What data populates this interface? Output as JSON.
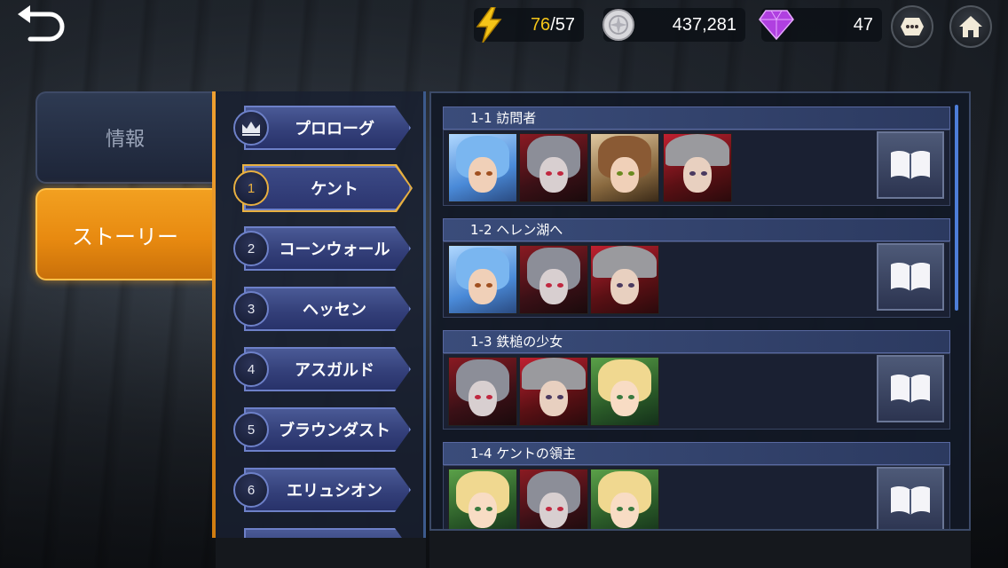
{
  "header": {
    "energy": "76/57",
    "energy_current": "76",
    "energy_max": "/57",
    "silver": "437,281",
    "gems": "47"
  },
  "tabs": [
    {
      "label": "情報",
      "active": false
    },
    {
      "label": "ストーリー",
      "active": true
    }
  ],
  "chapters": [
    {
      "badge": "",
      "label": "プロローグ",
      "icon": "crown-icon",
      "active": false
    },
    {
      "badge": "1",
      "label": "ケント",
      "active": true
    },
    {
      "badge": "2",
      "label": "コーンウォール",
      "active": false
    },
    {
      "badge": "3",
      "label": "ヘッセン",
      "active": false
    },
    {
      "badge": "4",
      "label": "アスガルド",
      "active": false
    },
    {
      "badge": "5",
      "label": "ブラウンダスト",
      "active": false
    },
    {
      "badge": "6",
      "label": "エリュシオン",
      "active": false
    }
  ],
  "episodes": [
    {
      "title": "1-1 訪問者",
      "portraits": [
        "blue-haired-elf",
        "gray-haired-knight",
        "brown-haired-girl",
        "helmeted-soldier"
      ]
    },
    {
      "title": "1-2 ヘレン湖へ",
      "portraits": [
        "blue-haired-elf",
        "gray-haired-knight",
        "helmeted-soldier"
      ]
    },
    {
      "title": "1-3 鉄槌の少女",
      "portraits": [
        "gray-haired-knight",
        "helmeted-soldier",
        "blonde-girl"
      ]
    },
    {
      "title": "1-4 ケントの領主",
      "portraits": [
        "blonde-girl",
        "gray-haired-knight",
        "blonde-boy"
      ]
    }
  ],
  "colors": {
    "accent_orange": "#f2a020",
    "chapter_blue": "#34407a",
    "active_gold": "#e8b040",
    "energy_yellow": "#f5c518",
    "gem_purple": "#b040e0"
  }
}
